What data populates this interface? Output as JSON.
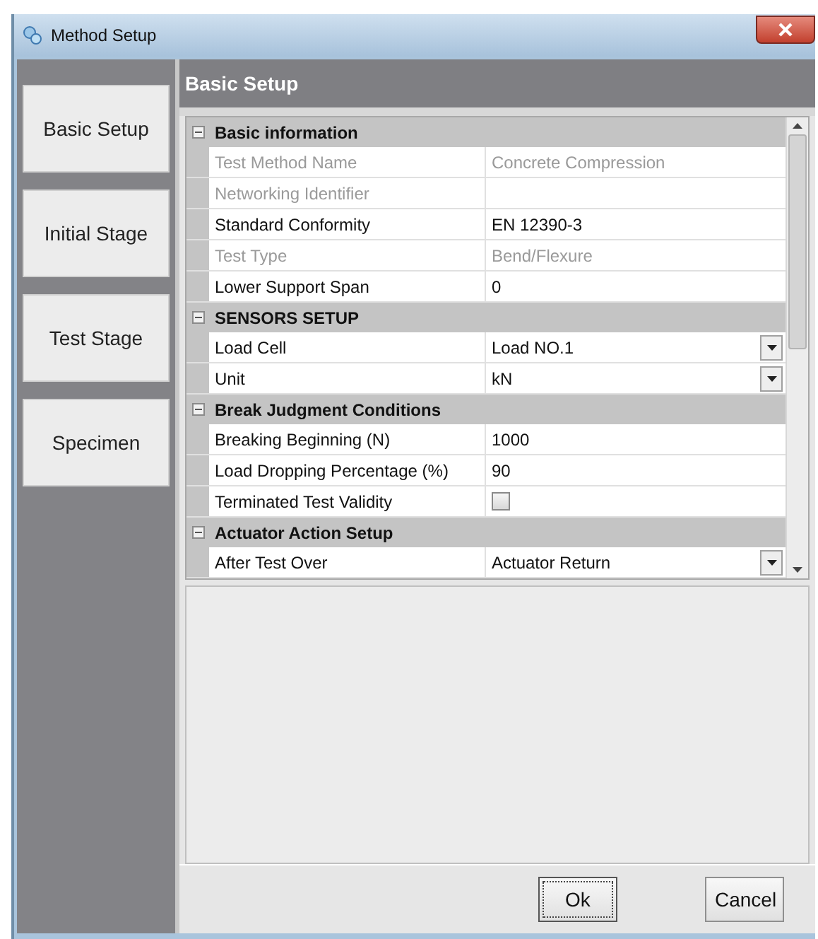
{
  "window": {
    "title": "Method Setup"
  },
  "sidebar": {
    "items": [
      {
        "label": "Basic Setup"
      },
      {
        "label": "Initial Stage"
      },
      {
        "label": "Test Stage"
      },
      {
        "label": "Specimen"
      }
    ]
  },
  "panel": {
    "title": "Basic Setup"
  },
  "grid": {
    "categories": [
      {
        "title": "Basic information",
        "expanded": true,
        "rows": [
          {
            "name": "Test Method Name",
            "value": "Concrete Compression",
            "kind": "text",
            "disabled": true
          },
          {
            "name": "Networking Identifier",
            "value": "",
            "kind": "text",
            "disabled": true
          },
          {
            "name": "Standard Conformity",
            "value": "EN 12390-3",
            "kind": "text",
            "disabled": false
          },
          {
            "name": "Test Type",
            "value": "Bend/Flexure",
            "kind": "text",
            "disabled": true
          },
          {
            "name": "Lower Support Span",
            "value": "0",
            "kind": "text",
            "disabled": false
          }
        ]
      },
      {
        "title": "SENSORS SETUP",
        "expanded": true,
        "rows": [
          {
            "name": "Load Cell",
            "value": "Load NO.1",
            "kind": "dropdown",
            "disabled": false
          },
          {
            "name": "Unit",
            "value": "kN",
            "kind": "dropdown",
            "disabled": false
          }
        ]
      },
      {
        "title": "Break Judgment Conditions",
        "expanded": true,
        "rows": [
          {
            "name": "Breaking Beginning (N)",
            "value": "1000",
            "kind": "text",
            "disabled": false
          },
          {
            "name": "Load Dropping Percentage (%)",
            "value": "90",
            "kind": "text",
            "disabled": false
          },
          {
            "name": "Terminated Test Validity",
            "kind": "checkbox",
            "checked": false,
            "disabled": false
          }
        ]
      },
      {
        "title": "Actuator Action Setup",
        "expanded": true,
        "rows": [
          {
            "name": "After Test Over",
            "value": "Actuator Return",
            "kind": "dropdown",
            "disabled": false
          }
        ]
      }
    ]
  },
  "buttons": [
    {
      "label": "Ok",
      "default": true
    },
    {
      "label": "Cancel",
      "default": false
    }
  ]
}
